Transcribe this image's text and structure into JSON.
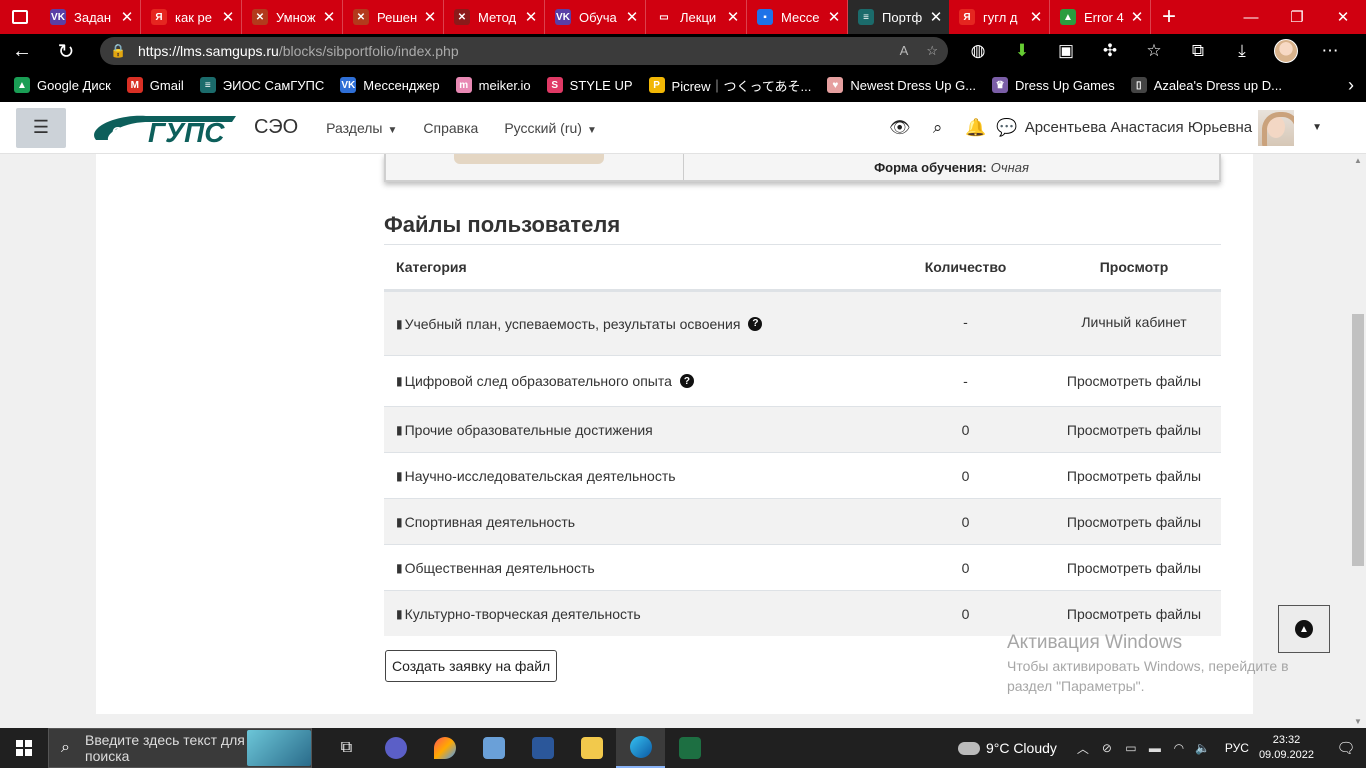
{
  "browser": {
    "tabs": [
      {
        "title": "Задан",
        "fav_color": "#5a3fa6",
        "fav_text": "VK",
        "active": false
      },
      {
        "title": "как ре",
        "fav_color": "#e52620",
        "fav_text": "Я",
        "active": false
      },
      {
        "title": "Умнож",
        "fav_color": "#b33a1c",
        "fav_text": "✕",
        "active": false
      },
      {
        "title": "Решен",
        "fav_color": "#b33a1c",
        "fav_text": "✕",
        "active": false
      },
      {
        "title": "Метод",
        "fav_color": "#8b1a1a",
        "fav_text": "✕",
        "active": false
      },
      {
        "title": "Обуча",
        "fav_color": "#5a3fa6",
        "fav_text": "VK",
        "active": false
      },
      {
        "title": "Лекци",
        "fav_color": "#d00010",
        "fav_text": "▭",
        "active": false
      },
      {
        "title": "Мессе",
        "fav_color": "#1e73e8",
        "fav_text": "▪",
        "active": false
      },
      {
        "title": "Портф",
        "fav_color": "#1b6b6b",
        "fav_text": "≡",
        "active": true
      },
      {
        "title": "гугл д",
        "fav_color": "#e52620",
        "fav_text": "Я",
        "active": false
      },
      {
        "title": "Error 4",
        "fav_color": "#2a9d3f",
        "fav_text": "▲",
        "active": false
      }
    ],
    "url_host": "https://lms.samgups.ru",
    "url_path": "/blocks/sibportfolio/index.php",
    "bookmarks": [
      {
        "label": "Google Диск",
        "color": "#1a9e55",
        "icon": "▲"
      },
      {
        "label": "Gmail",
        "color": "#d93025",
        "icon": "M"
      },
      {
        "label": "ЭИОС СамГУПС",
        "color": "#1b6b6b",
        "icon": "≡"
      },
      {
        "label": "Мессенджер",
        "color": "#2f6fd6",
        "icon": "VK"
      },
      {
        "label": "meiker.io",
        "color": "#e889b4",
        "icon": "m"
      },
      {
        "label": "STYLE UP",
        "color": "#e03a66",
        "icon": "S"
      },
      {
        "label": "Picrew｜つくってあそ...",
        "color": "#f2b705",
        "icon": "P"
      },
      {
        "label": "Newest Dress Up G...",
        "color": "#e6a0a0",
        "icon": "♥"
      },
      {
        "label": "Dress Up Games",
        "color": "#7b5ea7",
        "icon": "♛"
      },
      {
        "label": "Azalea's Dress up D...",
        "color": "#444444",
        "icon": "▯"
      }
    ]
  },
  "site": {
    "name": "СЭО",
    "nav": [
      {
        "label": "Разделы",
        "dropdown": true
      },
      {
        "label": "Справка",
        "dropdown": false
      },
      {
        "label": "Русский (ru)",
        "dropdown": true
      }
    ],
    "user_name": "Арсентьева Анастасия Юрьевна"
  },
  "profile": {
    "study_form_label": "Форма обучения:",
    "study_form_value": "Очная"
  },
  "files": {
    "title": "Файлы пользователя",
    "headers": [
      "Категория",
      "Количество",
      "Просмотр"
    ],
    "rows": [
      {
        "category": "Учебный план, успеваемость, результаты освоения",
        "count": "-",
        "view": "Личный кабинет",
        "help": true
      },
      {
        "category": "Цифровой след образовательного опыта",
        "count": "-",
        "view": "Просмотреть файлы",
        "help": true
      },
      {
        "category": "Прочие образовательные достижения",
        "count": "0",
        "view": "Просмотреть файлы",
        "help": false
      },
      {
        "category": "Научно-исследовательская деятельность",
        "count": "0",
        "view": "Просмотреть файлы",
        "help": false
      },
      {
        "category": "Спортивная деятельность",
        "count": "0",
        "view": "Просмотреть файлы",
        "help": false
      },
      {
        "category": "Общественная деятельность",
        "count": "0",
        "view": "Просмотреть файлы",
        "help": false
      },
      {
        "category": "Культурно-творческая деятельность",
        "count": "0",
        "view": "Просмотреть файлы",
        "help": false
      }
    ],
    "create_button": "Создать заявку на файл"
  },
  "activation": {
    "title": "Активация Windows",
    "line": "Чтобы активировать Windows, перейдите в раздел \"Параметры\"."
  },
  "taskbar": {
    "search_placeholder": "Введите здесь текст для поиска",
    "weather": "9°C  Cloudy",
    "lang": "РУС",
    "time": "23:32",
    "date": "09.09.2022"
  }
}
